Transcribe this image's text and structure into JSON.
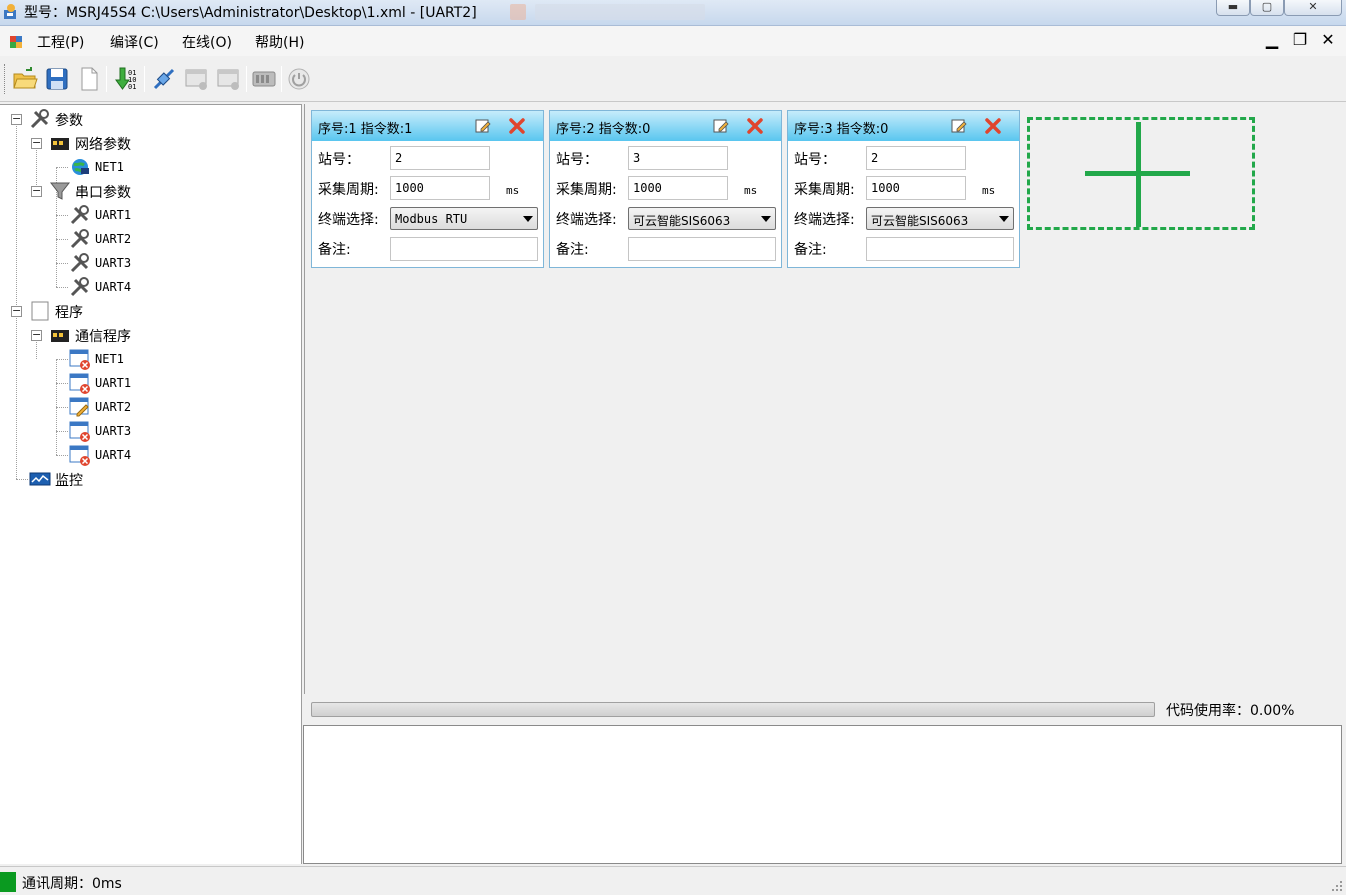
{
  "window": {
    "title": "型号：MSRJ45S4   C:\\Users\\Administrator\\Desktop\\1.xml - [UART2]",
    "minimize_glyph": "▬",
    "maximize_glyph": "▢",
    "close_glyph": "✕"
  },
  "menu": {
    "items": [
      "工程(P)",
      "编译(C)",
      "在线(O)",
      "帮助(H)"
    ],
    "mdi_min": "▁",
    "mdi_restore": "❐",
    "mdi_close": "✕"
  },
  "toolbar": {
    "buttons": [
      "open-folder-icon",
      "save-icon",
      "new-file-icon",
      "download-binary-icon",
      "connect-icon",
      "add-window-icon",
      "remove-window-icon",
      "device-icon",
      "power-icon"
    ]
  },
  "tree": {
    "params": "参数",
    "net_params": "网络参数",
    "net1": "NET1",
    "serial_params": "串口参数",
    "uart1": "UART1",
    "uart2": "UART2",
    "uart3": "UART3",
    "uart4": "UART4",
    "program": "程序",
    "comm_program": "通信程序",
    "prog_net1": "NET1",
    "prog_uart1": "UART1",
    "prog_uart2": "UART2",
    "prog_uart3": "UART3",
    "prog_uart4": "UART4",
    "monitor": "监控",
    "expand_minus": "−"
  },
  "labels": {
    "station": "站号：",
    "period": "采集周期:",
    "terminal": "终端选择:",
    "remark": "备注:",
    "unit_ms": "ms"
  },
  "cards": [
    {
      "title": "序号:1 指令数:1",
      "station": "2",
      "period": "1000",
      "terminal": "Modbus RTU",
      "remark": ""
    },
    {
      "title": "序号:2 指令数:0",
      "station": "3",
      "period": "1000",
      "terminal": "可云智能SIS6063",
      "remark": ""
    },
    {
      "title": "序号:3 指令数:0",
      "station": "2",
      "period": "1000",
      "terminal": "可云智能SIS6063",
      "remark": ""
    }
  ],
  "progress": {
    "usage_label": "代码使用率：0.00%",
    "value_percent": 0
  },
  "status": {
    "text": "通讯周期：0ms"
  },
  "colors": {
    "accent_green": "#22a84a",
    "card_header": "#59c6ef",
    "status_led": "#0a9a20"
  }
}
